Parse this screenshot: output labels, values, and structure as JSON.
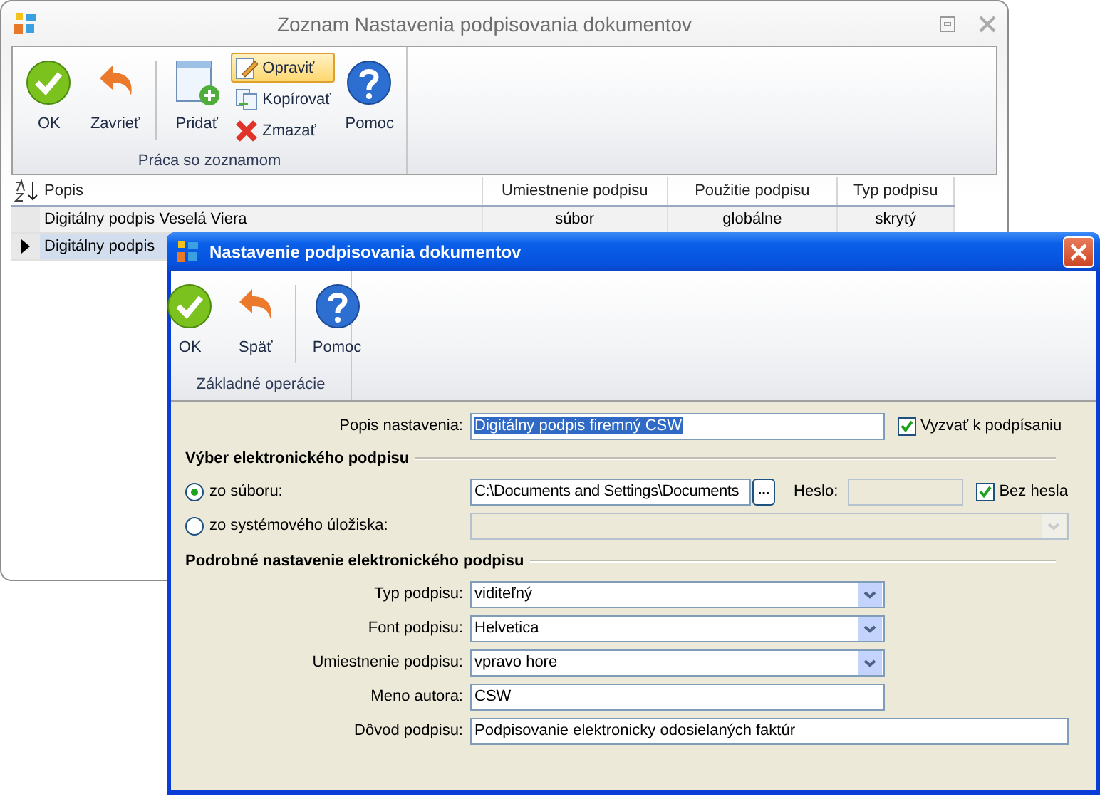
{
  "back_window": {
    "title": "Zoznam Nastavenia podpisovania dokumentov",
    "toolbar": {
      "group_label": "Práca so zoznamom",
      "buttons": [
        {
          "label": "OK",
          "kind": "large",
          "highlighted": false
        },
        {
          "label": "Zavrieť",
          "kind": "large",
          "highlighted": false
        },
        {
          "label": "Pridať",
          "kind": "large",
          "highlighted": false
        },
        {
          "label": "Opraviť",
          "kind": "small",
          "highlighted": true
        },
        {
          "label": "Kopírovať",
          "kind": "small",
          "highlighted": false
        },
        {
          "label": "Zmazať",
          "kind": "small",
          "highlighted": false
        },
        {
          "label": "Pomoc",
          "kind": "large",
          "highlighted": false
        }
      ]
    },
    "table": {
      "columns": [
        "Popis",
        "Umiestnenie podpisu",
        "Použitie podpisu",
        "Typ podpisu"
      ],
      "rows": [
        {
          "cells": [
            "Digitálny podpis Veselá Viera",
            "súbor",
            "globálne",
            "skrytý"
          ],
          "selected": false
        },
        {
          "cells": [
            "Digitálny podpis"
          ],
          "selected": true
        }
      ]
    }
  },
  "dialog": {
    "title": "Nastavenie podpisovania dokumentov",
    "toolbar": {
      "group_label": "Základné operácie",
      "buttons": [
        {
          "label": "OK"
        },
        {
          "label": "Späť"
        },
        {
          "label": "Pomoc"
        }
      ]
    },
    "description": {
      "label": "Popis nastavenia:",
      "value": "Digitálny podpis firemný CSW"
    },
    "prompt_checkbox": {
      "label": "Vyzvať k podpísaniu",
      "checked": true
    },
    "selection_section": {
      "heading": "Výber elektronického podpisu",
      "sources": [
        {
          "label": "zo súboru:",
          "selected": true
        },
        {
          "label": "zo systémového úložiska:",
          "selected": false
        }
      ],
      "file_path": "C:\\Documents and Settings\\Documents",
      "browse_button": "...",
      "password_label": "Heslo:",
      "no_password": {
        "label": "Bez hesla",
        "checked": true
      }
    },
    "details_section": {
      "heading": "Podrobné nastavenie elektronického podpisu",
      "fields": [
        {
          "label": "Typ podpisu:",
          "value": "viditeľný",
          "kind": "select"
        },
        {
          "label": "Font podpisu:",
          "value": "Helvetica",
          "kind": "select"
        },
        {
          "label": "Umiestnenie podpisu:",
          "value": "vpravo hore",
          "kind": "select"
        },
        {
          "label": "Meno autora:",
          "value": "CSW",
          "kind": "text"
        },
        {
          "label": "Dôvod podpisu:",
          "value": "Podpisovanie elektronicky odosielaných faktúr",
          "kind": "wide"
        }
      ]
    }
  }
}
